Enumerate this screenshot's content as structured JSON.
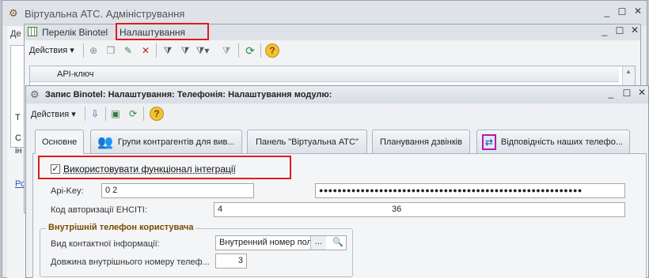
{
  "main_window": {
    "title": "Віртуальна АТС. Адміністрування"
  },
  "left_panel": {
    "tab_fragment": "Де",
    "link_fragment": "Ро",
    "text_t": "Т",
    "text_c": "С",
    "text_i": "ін"
  },
  "list_window": {
    "title": "Перелік Binotel",
    "tab_settings": "Налаштування",
    "actions_label": "Действия",
    "column_header": "API-ключ"
  },
  "record_window": {
    "title": "Запис Binotel: Налаштування: Телефонія: Налаштування модулю:",
    "actions_label": "Действия",
    "tabs": [
      {
        "label": "Основне"
      },
      {
        "label": "Групи контрагентів для вив..."
      },
      {
        "label": "Панель \"Віртуальна АТС\""
      },
      {
        "label": "Планування дзвінків"
      },
      {
        "label": "Відповідність наших телефо..."
      }
    ],
    "use_integration_label": "Використовувати функціонал інтеграції",
    "use_integration_checked": true,
    "api_key_label": "Api-Key:",
    "api_key_value": "0                     2",
    "api_secret_value": "●●●●●●●●●●●●●●●●●●●●●●●●●●●●●●●●●●●●●●●●●●●●●●●●●●●●●●●●●",
    "auth_code_label": "Код авторизації ЕНСІТІ:",
    "auth_code_value": "4                                                                      36",
    "internal_phone": {
      "group_title": "Внутрішній телефон користувача",
      "contact_info_label": "Вид контактної інформації:",
      "contact_info_value": "Внутренний номер пол",
      "length_label": "Довжина внутрішнього номеру телеф...",
      "length_value": "3"
    }
  },
  "colors": {
    "highlight": "#e01b1b",
    "link": "#2a56c6",
    "group_title": "#7a4a00"
  },
  "icons": [
    "document-icon",
    "grid-icon",
    "gear-icon",
    "help-icon",
    "delete-icon",
    "refresh-icon",
    "group-icon",
    "phone-sync-icon"
  ]
}
